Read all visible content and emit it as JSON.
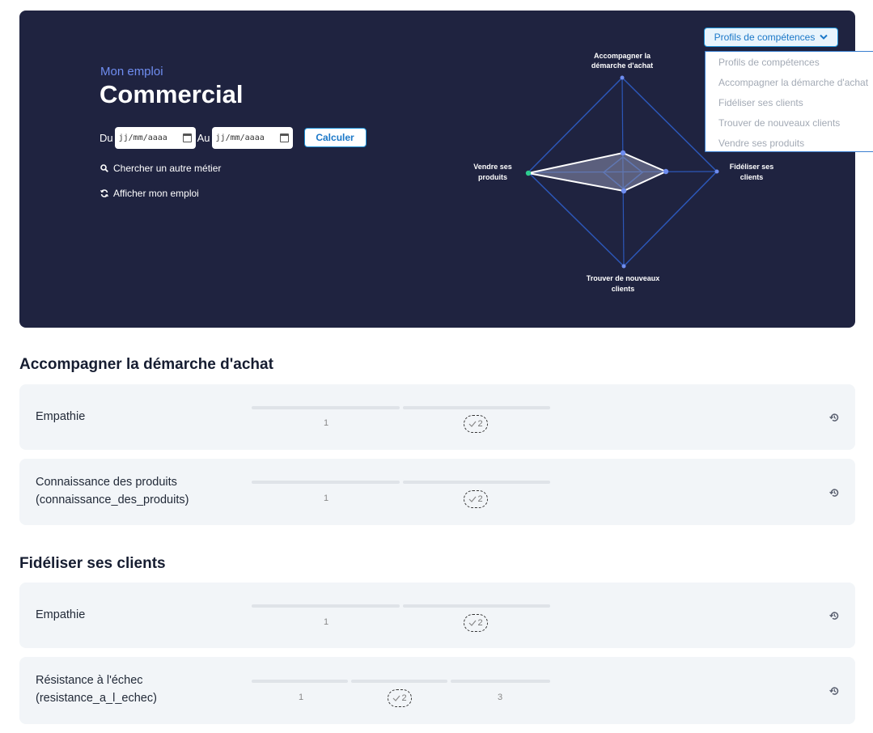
{
  "hero": {
    "subtitle": "Mon emploi",
    "title": "Commercial",
    "from_label": "Du",
    "from_value": "jj/mm/aaaa",
    "to_label": "Au",
    "to_value": "jj/mm/aaaa",
    "calc_label": "Calculer",
    "search_link": "Chercher un autre métier",
    "show_link": "Afficher mon emploi"
  },
  "radar": {
    "label_top_1": "Accompagner la",
    "label_top_2": "démarche d'achat",
    "label_right_1": "Fidéliser ses",
    "label_right_2": "clients",
    "label_bottom_1": "Trouver de nouveaux",
    "label_bottom_2": "clients",
    "label_left_1": "Vendre ses",
    "label_left_2": "produits"
  },
  "profiles": {
    "button_label": "Profils de compétences",
    "options": [
      "Profils de compétences",
      "Accompagner la démarche d'achat",
      "Fidéliser ses clients",
      "Trouver de nouveaux clients",
      "Vendre ses produits"
    ]
  },
  "sections": [
    {
      "title": "Accompagner la démarche d'achat",
      "skills": [
        {
          "line1": "Empathie",
          "line2": "",
          "levels": [
            "1",
            "2"
          ],
          "current": "2"
        },
        {
          "line1": "Connaissance des produits",
          "line2": "(connaissance_des_produits)",
          "levels": [
            "1",
            "2"
          ],
          "current": "2"
        }
      ]
    },
    {
      "title": "Fidéliser ses clients",
      "skills": [
        {
          "line1": "Empathie",
          "line2": "",
          "levels": [
            "1",
            "2"
          ],
          "current": "2"
        },
        {
          "line1": "Résistance à l'échec",
          "line2": "(resistance_a_l_echec)",
          "levels": [
            "1",
            "2",
            "3"
          ],
          "current": "2"
        }
      ]
    }
  ],
  "colors": {
    "hero_bg": "#1f2340",
    "accent": "#1b8fd6",
    "subtitle": "#6f8df0",
    "card_bg": "#f2f5f8"
  }
}
